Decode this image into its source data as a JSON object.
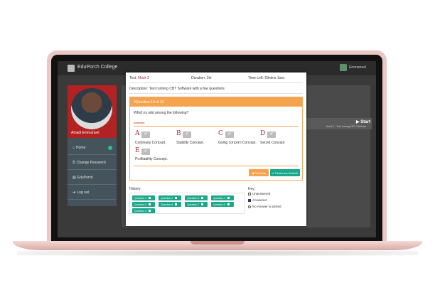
{
  "app": {
    "brand": "EduPorch College",
    "user": "Emmanuel"
  },
  "sidebar": {
    "profile_name": "Amadi Emmanuel",
    "items": [
      {
        "label": "Home",
        "icon": "home-icon"
      },
      {
        "label": "Change Password",
        "icon": "key-icon"
      },
      {
        "label": "EduPorch",
        "icon": "book-icon"
      },
      {
        "label": "Log out",
        "icon": "logout-icon"
      }
    ]
  },
  "background": {
    "start_label": "▶ Start",
    "start_sub": "Mock 2 - Test running CBT Software"
  },
  "modal": {
    "test_label": "Test:",
    "test_value": "Mock 2",
    "duration": "Duration: 1hr",
    "time_left": "Time Left: 59mins 1sec",
    "description": "Description: Test running CBT Software with a few questions",
    "question_header": "#Question 10 of 10",
    "question_text": "Which is odd among the following?",
    "answers_label": "Answers",
    "options": [
      {
        "letter": "A",
        "label": "Continuity Concept."
      },
      {
        "letter": "B",
        "label": "Stability Concept."
      },
      {
        "letter": "C",
        "label": "Going concern Concept."
      },
      {
        "letter": "D",
        "label": "Secret Concept"
      },
      {
        "letter": "E",
        "label": "Profitability Concept."
      }
    ],
    "check_glyph": "✔",
    "previous_label": "◀ Previous",
    "submit_label": "✔ Finish and Submit",
    "history_label": "History",
    "history": [
      "Question 1",
      "Question 2",
      "Question 3",
      "Question 4",
      "Question 5",
      "Question 6",
      "Question 7",
      "Question 8",
      "Question 9"
    ],
    "key_label": "Key:",
    "key_items": [
      "Unanswered",
      "Answered",
      "No Answer is picked"
    ]
  },
  "colors": {
    "accent": "#f6a34f",
    "primary": "#1aa88a",
    "brand_red": "#b22222",
    "laptop": "#e8c7c4"
  }
}
